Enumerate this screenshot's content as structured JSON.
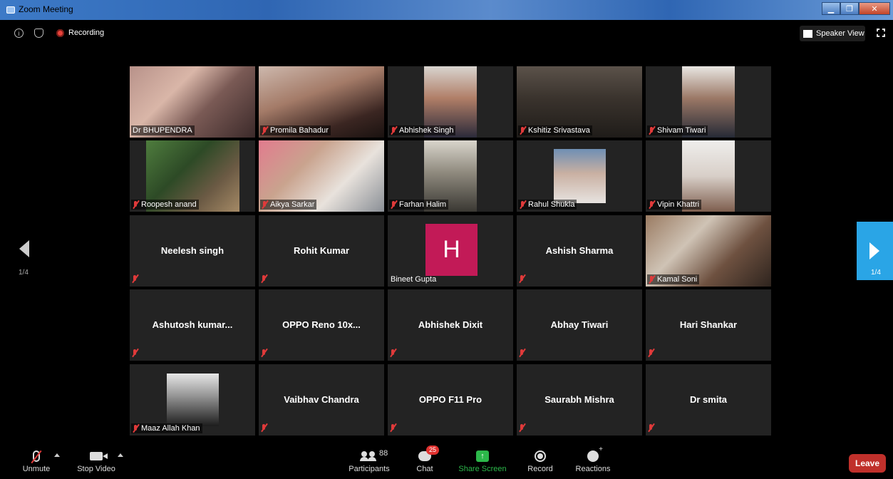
{
  "window": {
    "title": "Zoom Meeting"
  },
  "topbar": {
    "recording_label": "Recording",
    "speaker_view_label": "Speaker View"
  },
  "navigation": {
    "left_page": "1/4",
    "right_page": "1/4"
  },
  "tiles": [
    {
      "name": "Dr BHUPENDRA",
      "video": true
    },
    {
      "name": "Promila Bahadur",
      "video": true,
      "muted": true
    },
    {
      "name": "Abhishek Singh",
      "video": true,
      "muted": true
    },
    {
      "name": "Kshitiz Srivastava",
      "video": true,
      "muted": true
    },
    {
      "name": "Shivam Tiwari",
      "video": true,
      "muted": true
    },
    {
      "name": "Roopesh anand",
      "video": true,
      "muted": true
    },
    {
      "name": "Aikya Sarkar",
      "video": true,
      "muted": true
    },
    {
      "name": "Farhan Halim",
      "video": true,
      "muted": true
    },
    {
      "name": "Rahul Shukla",
      "video": true,
      "muted": true
    },
    {
      "name": "Vipin Khattri",
      "video": true,
      "muted": true
    },
    {
      "name": "Neelesh singh",
      "video": false,
      "muted": true
    },
    {
      "name": "Rohit Kumar",
      "video": false,
      "muted": true
    },
    {
      "name": "Bineet Gupta",
      "video": false,
      "avatar_letter": "H"
    },
    {
      "name": "Ashish Sharma",
      "video": false,
      "muted": true
    },
    {
      "name": "Kamal Soni",
      "video": true,
      "muted": true
    },
    {
      "name": "Ashutosh  kumar...",
      "video": false,
      "muted": true
    },
    {
      "name": "OPPO Reno  10x...",
      "video": false,
      "muted": true
    },
    {
      "name": "Abhishek Dixit",
      "video": false,
      "muted": true
    },
    {
      "name": "Abhay Tiwari",
      "video": false,
      "muted": true
    },
    {
      "name": "Hari Shankar",
      "video": false,
      "muted": true
    },
    {
      "name": "Maaz Allah Khan",
      "video": true,
      "muted": true
    },
    {
      "name": "Vaibhav Chandra",
      "video": false,
      "muted": true
    },
    {
      "name": "OPPO F11 Pro",
      "video": false,
      "muted": true
    },
    {
      "name": "Saurabh Mishra",
      "video": false,
      "muted": true
    },
    {
      "name": "Dr smita",
      "video": false,
      "muted": true
    }
  ],
  "toolbar": {
    "unmute": "Unmute",
    "stop_video": "Stop Video",
    "participants": "Participants",
    "participants_count": "88",
    "chat": "Chat",
    "chat_badge": "25",
    "share_screen": "Share Screen",
    "record": "Record",
    "reactions": "Reactions",
    "leave": "Leave"
  },
  "colors": {
    "active_speaker": "#b8d439",
    "share_green": "#2cb84a",
    "leave_red": "#c0302b",
    "nav_blue": "#2aa5e6",
    "avatar_h": "#c21a57"
  }
}
